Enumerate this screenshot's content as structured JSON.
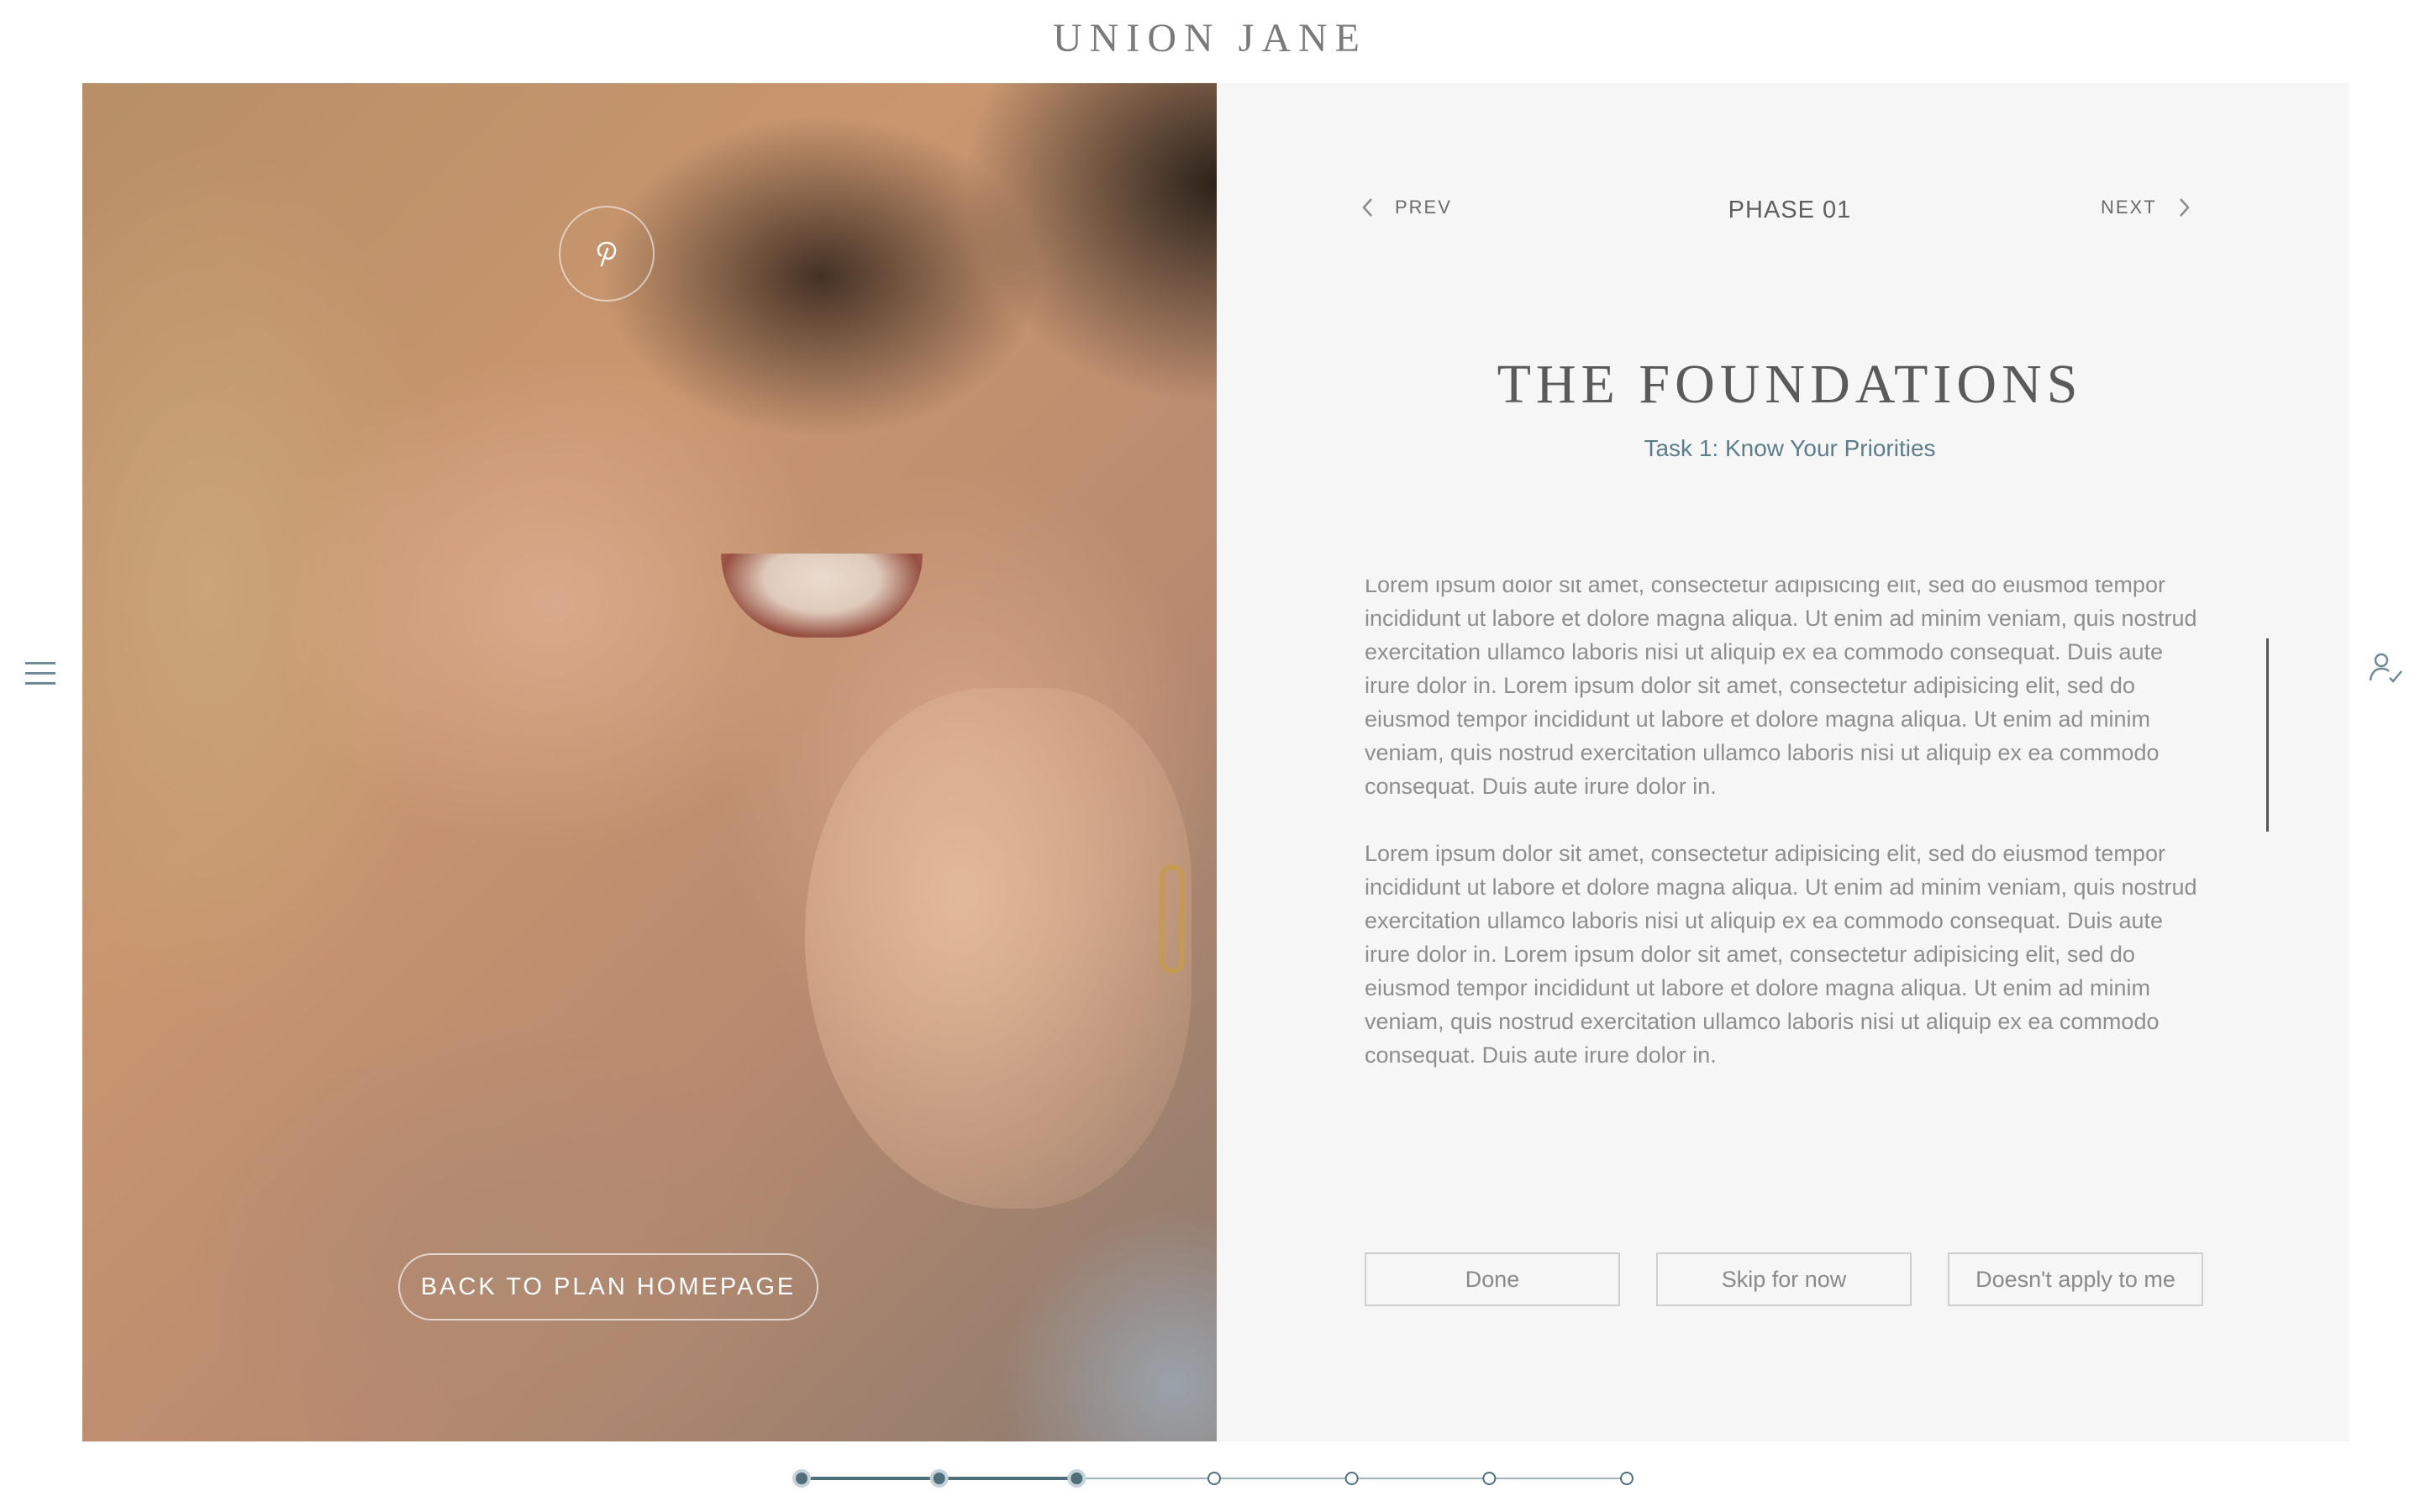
{
  "header": {
    "brand": "UNION JANE"
  },
  "nav": {
    "prev_label": "PREV",
    "next_label": "NEXT",
    "phase_label": "PHASE 01"
  },
  "content": {
    "title": "THE FOUNDATIONS",
    "subtitle": "Task 1: Know Your Priorities",
    "paragraphs": [
      "Lorem ipsum dolor sit amet, consectetur adipisicing elit, sed do eiusmod tempor incididunt ut labore et dolore magna aliqua. Ut enim ad minim veniam, quis nostrud exercitation ullamco laboris nisi ut aliquip ex ea commodo consequat. Duis aute irure dolor in. Lorem ipsum dolor sit amet, consectetur adipisicing elit, sed do eiusmod tempor incididunt ut labore et dolore magna aliqua. Ut enim ad minim veniam, quis nostrud exercitation ullamco laboris nisi ut aliquip ex ea commodo consequat. Duis aute irure dolor in.",
      "Lorem ipsum dolor sit amet, consectetur adipisicing elit, sed do eiusmod tempor incididunt ut labore et dolore magna aliqua. Ut enim ad minim veniam, quis nostrud exercitation ullamco laboris nisi ut aliquip ex ea commodo consequat. Duis aute irure dolor in. Lorem ipsum dolor sit amet, consectetur adipisicing elit, sed do eiusmod tempor incididunt ut labore et dolore magna aliqua. Ut enim ad minim veniam, quis nostrud exercitation ullamco laboris nisi ut aliquip ex ea commodo consequat. Duis aute irure dolor in."
    ]
  },
  "actions": {
    "done_label": "Done",
    "skip_label": "Skip for now",
    "not_apply_label": "Doesn't apply to me"
  },
  "photo": {
    "back_button_label": "BACK TO PLAN HOMEPAGE"
  },
  "icons": {
    "menu": "hamburger-menu-icon",
    "account": "user-check-icon",
    "share": "pinterest-icon",
    "prev": "chevron-left-icon",
    "next": "chevron-right-icon"
  },
  "progress": {
    "total_steps": 7,
    "completed_steps": 3
  },
  "colors": {
    "accent": "#4f6f7b",
    "accent_light": "#9fb4bb",
    "panel_bg": "#f6f6f6",
    "text": "#6b6b6b",
    "body_text": "#8e8e8e"
  }
}
